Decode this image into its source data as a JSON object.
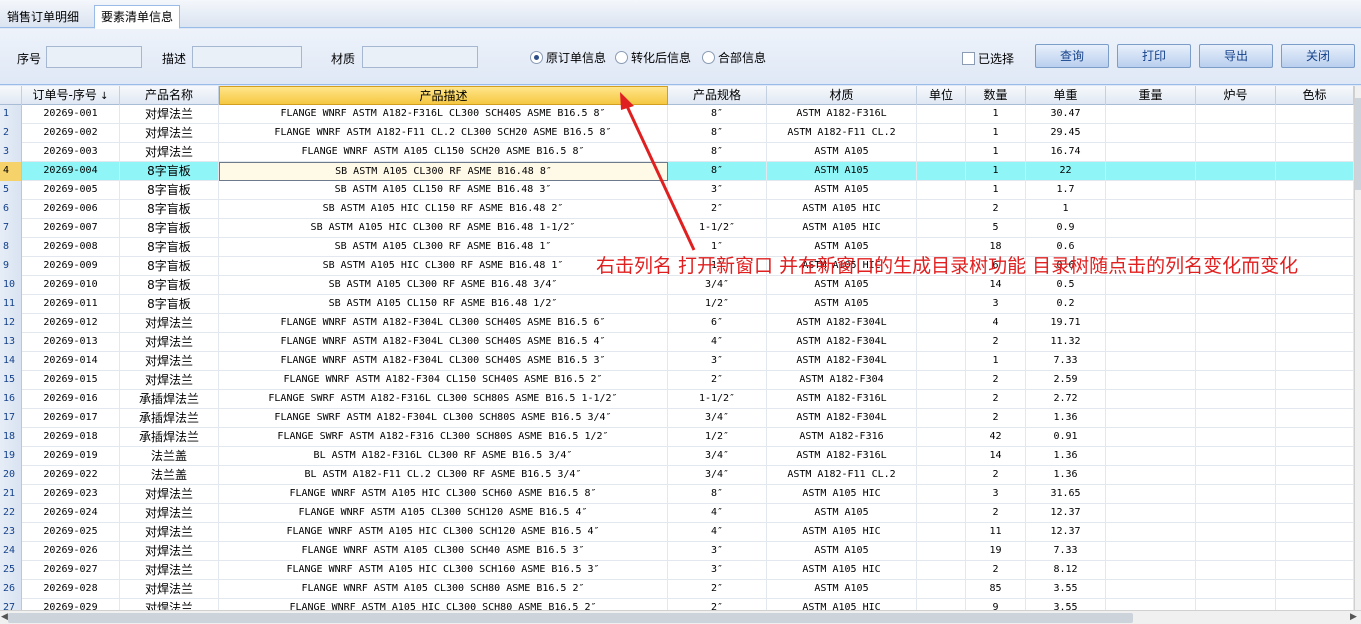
{
  "tabs": [
    {
      "label": "销售订单明细"
    },
    {
      "label": "要素清单信息"
    }
  ],
  "filters": {
    "seq_label": "序号",
    "desc_label": "描述",
    "material_label": "材质",
    "seq_value": "",
    "desc_value": "",
    "material_value": ""
  },
  "radios": [
    {
      "label": "原订单信息",
      "checked": true
    },
    {
      "label": "转化后信息",
      "checked": false
    },
    {
      "label": "合部信息",
      "checked": false
    }
  ],
  "selected_checkbox": {
    "label": "已选择",
    "checked": false
  },
  "buttons": {
    "query": "查询",
    "print": "打印",
    "export": "导出",
    "close": "关闭"
  },
  "columns": [
    "订单号-序号",
    "产品名称",
    "产品描述",
    "产品规格",
    "材质",
    "单位",
    "数量",
    "单重",
    "重量",
    "炉号",
    "色标"
  ],
  "sort_indicator": "↓",
  "selected_column": "产品描述",
  "highlight_row": 4,
  "rows": [
    [
      "1",
      "20269-001",
      "对焊法兰",
      "FLANGE WNRF ASTM A182-F316L CL300 SCH40S ASME B16.5 8″",
      "8″",
      "ASTM A182-F316L",
      "",
      "1",
      "30.47"
    ],
    [
      "2",
      "20269-002",
      "对焊法兰",
      "FLANGE WNRF ASTM A182-F11 CL.2 CL300 SCH20 ASME B16.5 8″",
      "8″",
      "ASTM A182-F11 CL.2",
      "",
      "1",
      "29.45"
    ],
    [
      "3",
      "20269-003",
      "对焊法兰",
      "FLANGE WNRF ASTM A105 CL150 SCH20 ASME B16.5 8″",
      "8″",
      "ASTM A105",
      "",
      "1",
      "16.74"
    ],
    [
      "4",
      "20269-004",
      "8字盲板",
      "SB ASTM A105 CL300 RF ASME B16.48 8″",
      "8″",
      "ASTM A105",
      "",
      "1",
      "22"
    ],
    [
      "5",
      "20269-005",
      "8字盲板",
      "SB ASTM A105 CL150 RF ASME B16.48 3″",
      "3″",
      "ASTM A105",
      "",
      "1",
      "1.7"
    ],
    [
      "6",
      "20269-006",
      "8字盲板",
      "SB ASTM A105 HIC CL150 RF ASME B16.48 2″",
      "2″",
      "ASTM A105 HIC",
      "",
      "2",
      "1"
    ],
    [
      "7",
      "20269-007",
      "8字盲板",
      "SB ASTM A105 HIC CL300 RF ASME B16.48 1-1/2″",
      "1-1/2″",
      "ASTM A105 HIC",
      "",
      "5",
      "0.9"
    ],
    [
      "8",
      "20269-008",
      "8字盲板",
      "SB ASTM A105 CL300 RF ASME B16.48 1″",
      "1″",
      "ASTM A105",
      "",
      "18",
      "0.6"
    ],
    [
      "9",
      "20269-009",
      "8字盲板",
      "SB ASTM A105 HIC CL300 RF ASME B16.48 1″",
      "1″",
      "ASTM A105 HIC",
      "",
      "6",
      "0.6"
    ],
    [
      "10",
      "20269-010",
      "8字盲板",
      "SB ASTM A105 CL300 RF ASME B16.48 3/4″",
      "3/4″",
      "ASTM A105",
      "",
      "14",
      "0.5"
    ],
    [
      "11",
      "20269-011",
      "8字盲板",
      "SB ASTM A105 CL150 RF ASME B16.48 1/2″",
      "1/2″",
      "ASTM A105",
      "",
      "3",
      "0.2"
    ],
    [
      "12",
      "20269-012",
      "对焊法兰",
      "FLANGE WNRF ASTM A182-F304L CL300 SCH40S ASME B16.5 6″",
      "6″",
      "ASTM A182-F304L",
      "",
      "4",
      "19.71"
    ],
    [
      "13",
      "20269-013",
      "对焊法兰",
      "FLANGE WNRF ASTM A182-F304L CL300 SCH40S ASME B16.5 4″",
      "4″",
      "ASTM A182-F304L",
      "",
      "2",
      "11.32"
    ],
    [
      "14",
      "20269-014",
      "对焊法兰",
      "FLANGE WNRF ASTM A182-F304L CL300 SCH40S ASME B16.5 3″",
      "3″",
      "ASTM A182-F304L",
      "",
      "1",
      "7.33"
    ],
    [
      "15",
      "20269-015",
      "对焊法兰",
      "FLANGE WNRF ASTM A182-F304 CL150 SCH40S ASME B16.5 2″",
      "2″",
      "ASTM A182-F304",
      "",
      "2",
      "2.59"
    ],
    [
      "16",
      "20269-016",
      "承插焊法兰",
      "FLANGE SWRF ASTM A182-F316L CL300 SCH80S ASME B16.5 1-1/2″",
      "1-1/2″",
      "ASTM A182-F316L",
      "",
      "2",
      "2.72"
    ],
    [
      "17",
      "20269-017",
      "承插焊法兰",
      "FLANGE SWRF ASTM A182-F304L CL300 SCH80S ASME B16.5 3/4″",
      "3/4″",
      "ASTM A182-F304L",
      "",
      "2",
      "1.36"
    ],
    [
      "18",
      "20269-018",
      "承插焊法兰",
      "FLANGE SWRF ASTM A182-F316 CL300 SCH80S ASME B16.5 1/2″",
      "1/2″",
      "ASTM A182-F316",
      "",
      "42",
      "0.91"
    ],
    [
      "19",
      "20269-019",
      "法兰盖",
      "BL ASTM A182-F316L CL300 RF ASME B16.5 3/4″",
      "3/4″",
      "ASTM A182-F316L",
      "",
      "14",
      "1.36"
    ],
    [
      "20",
      "20269-022",
      "法兰盖",
      "BL ASTM A182-F11 CL.2 CL300 RF ASME B16.5 3/4″",
      "3/4″",
      "ASTM A182-F11 CL.2",
      "",
      "2",
      "1.36"
    ],
    [
      "21",
      "20269-023",
      "对焊法兰",
      "FLANGE WNRF ASTM A105 HIC CL300 SCH60 ASME B16.5 8″",
      "8″",
      "ASTM A105 HIC",
      "",
      "3",
      "31.65"
    ],
    [
      "22",
      "20269-024",
      "对焊法兰",
      "FLANGE WNRF ASTM A105 CL300 SCH120 ASME B16.5 4″",
      "4″",
      "ASTM A105",
      "",
      "2",
      "12.37"
    ],
    [
      "23",
      "20269-025",
      "对焊法兰",
      "FLANGE WNRF ASTM A105 HIC CL300 SCH120 ASME B16.5 4″",
      "4″",
      "ASTM A105 HIC",
      "",
      "11",
      "12.37"
    ],
    [
      "24",
      "20269-026",
      "对焊法兰",
      "FLANGE WNRF ASTM A105 CL300 SCH40 ASME B16.5 3″",
      "3″",
      "ASTM A105",
      "",
      "19",
      "7.33"
    ],
    [
      "25",
      "20269-027",
      "对焊法兰",
      "FLANGE WNRF ASTM A105 HIC CL300 SCH160 ASME B16.5 3″",
      "3″",
      "ASTM A105 HIC",
      "",
      "2",
      "8.12"
    ],
    [
      "26",
      "20269-028",
      "对焊法兰",
      "FLANGE WNRF ASTM A105 CL300 SCH80 ASME B16.5 2″",
      "2″",
      "ASTM A105",
      "",
      "85",
      "3.55"
    ],
    [
      "27",
      "20269-029",
      "对焊法兰",
      "FLANGE WNRF ASTM A105 HIC CL300 SCH80 ASME B16.5 2″",
      "2″",
      "ASTM A105 HIC",
      "",
      "9",
      "3.55"
    ]
  ],
  "annotation": "右击列名 打开新窗口 并在新窗口的生成目录树功能  目录树随点击的列名变化而变化",
  "colors": {
    "highlight": "#8ff5f6",
    "selected_header": "#f5c842",
    "annotation": "#e02020"
  }
}
